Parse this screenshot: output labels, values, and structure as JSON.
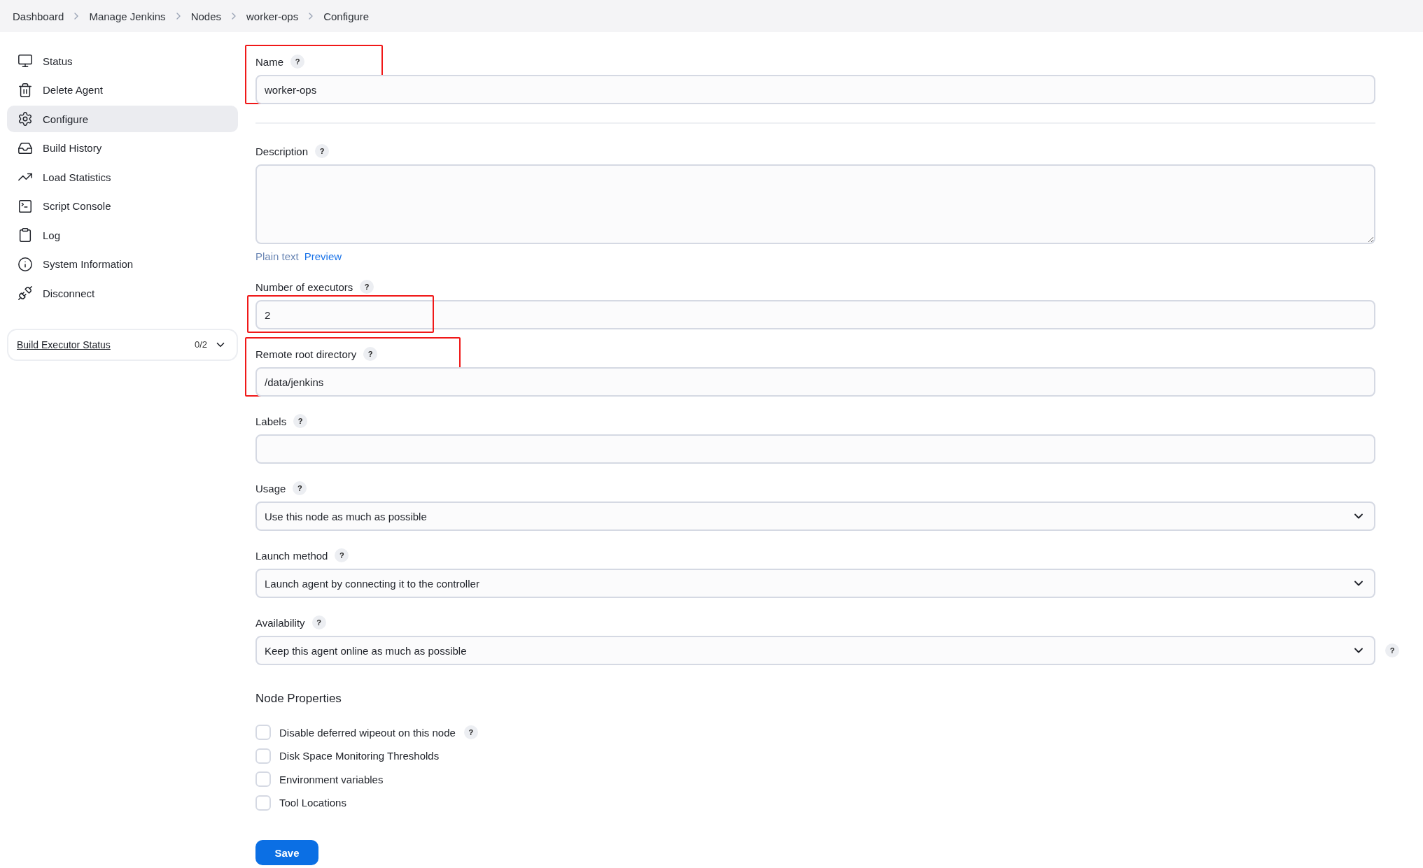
{
  "breadcrumbs": [
    "Dashboard",
    "Manage Jenkins",
    "Nodes",
    "worker-ops",
    "Configure"
  ],
  "sidebar": {
    "items": [
      {
        "label": "Status",
        "selected": false
      },
      {
        "label": "Delete Agent",
        "selected": false
      },
      {
        "label": "Configure",
        "selected": true
      },
      {
        "label": "Build History",
        "selected": false
      },
      {
        "label": "Load Statistics",
        "selected": false
      },
      {
        "label": "Script Console",
        "selected": false
      },
      {
        "label": "Log",
        "selected": false
      },
      {
        "label": "System Information",
        "selected": false
      },
      {
        "label": "Disconnect",
        "selected": false
      }
    ],
    "executor_status": {
      "title": "Build Executor Status",
      "count": "0/2"
    }
  },
  "form": {
    "fields": [
      {
        "kind": "text",
        "label": "Name",
        "help": "?",
        "value": "worker-ops",
        "highlighted": true
      },
      {
        "kind": "textarea",
        "label": "Description",
        "help": "?",
        "format": "Plain text",
        "preview": "Preview",
        "highlighted": false
      },
      {
        "kind": "text",
        "label": "Number of executors",
        "help": "?",
        "value": "2",
        "highlighted": true
      },
      {
        "kind": "text",
        "label": "Remote root directory",
        "help": "?",
        "value": "/data/jenkins",
        "highlighted": true
      },
      {
        "kind": "text",
        "label": "Labels",
        "help": "?",
        "highlighted": false
      },
      {
        "kind": "select",
        "label": "Usage",
        "help": "?",
        "value": "Use this node as much as possible",
        "highlighted": false
      },
      {
        "kind": "select",
        "label": "Launch method",
        "help": "?",
        "value": "Launch agent by connecting it to the controller",
        "highlighted": false
      },
      {
        "kind": "select",
        "label": "Availability",
        "help": "?",
        "value": "Keep this agent online as much as possible",
        "side_help": "?",
        "highlighted": false
      }
    ],
    "section": "Node Properties",
    "properties": [
      {
        "label": "Disable deferred wipeout on this node",
        "checked": false,
        "help": "?"
      },
      {
        "label": "Disk Space Monitoring Thresholds",
        "checked": false
      },
      {
        "label": "Environment variables",
        "checked": false
      },
      {
        "label": "Tool Locations",
        "checked": false
      }
    ],
    "save": "Save"
  }
}
